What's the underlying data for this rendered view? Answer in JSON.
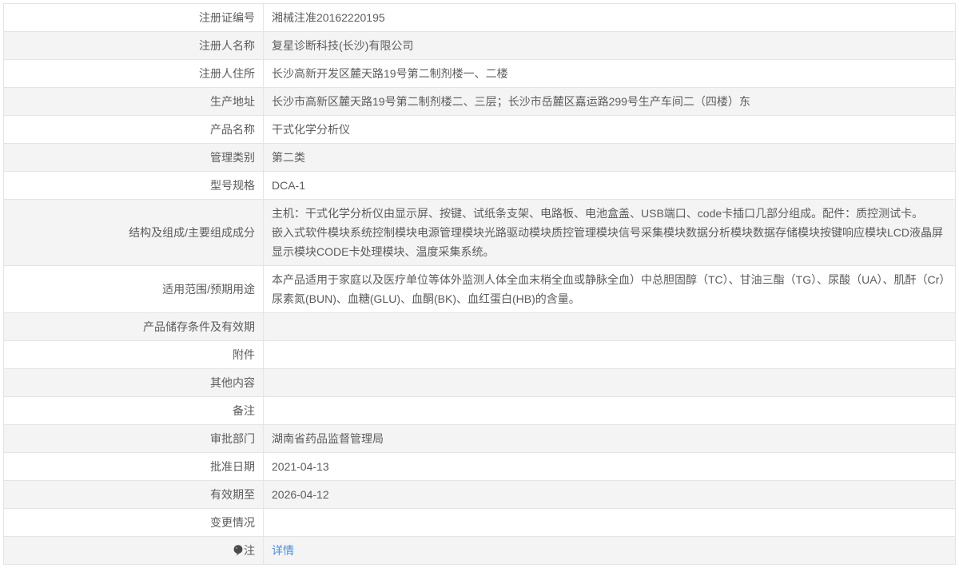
{
  "page": {
    "background": "#ffffff"
  },
  "table": {
    "colors": {
      "row_alt_bg": "#f4f4f4",
      "border": "#e4e4e4",
      "text": "#5c5c5c",
      "link": "#4a90d9",
      "note_icon": "#4a4a4a"
    },
    "label_column_width": 325,
    "rows": [
      {
        "key": "registration-cert-number",
        "label": "注册证编号",
        "value": "湘械注准20162220195"
      },
      {
        "key": "registrant-name",
        "label": "注册人名称",
        "value": "复星诊断科技(长沙)有限公司"
      },
      {
        "key": "registrant-address",
        "label": "注册人住所",
        "value": "长沙高新开发区麓天路19号第二制剂楼一、二楼"
      },
      {
        "key": "production-address",
        "label": "生产地址",
        "value": "长沙市高新区麓天路19号第二制剂楼二、三层；长沙市岳麓区嘉运路299号生产车间二（四楼）东"
      },
      {
        "key": "product-name",
        "label": "产品名称",
        "value": "干式化学分析仪"
      },
      {
        "key": "management-category",
        "label": "管理类别",
        "value": "第二类"
      },
      {
        "key": "model-spec",
        "label": "型号规格",
        "value": "DCA-1"
      },
      {
        "key": "structure-composition",
        "label": "结构及组成/主要组成成分",
        "value": "主机：干式化学分析仪由显示屏、按键、试纸条支架、电路板、电池盒盖、USB端口、code卡插口几部分组成。配件：质控测试卡。\n嵌入式软件模块系统控制模块电源管理模块光路驱动模块质控管理模块信号采集模块数据分析模块数据存储模块按键响应模块LCD液晶屏显示模块CODE卡处理模块、温度采集系统。"
      },
      {
        "key": "scope-of-application",
        "label": "适用范围/预期用途",
        "value": "本产品适用于家庭以及医疗单位等体外监测人体全血末梢全血或静脉全血）中总胆固醇（TC）、甘油三酯（TG）、尿酸（UA）、肌酐（Cr）尿素氮(BUN)、血糖(GLU)、血酮(BK)、血红蛋白(HB)的含量。"
      },
      {
        "key": "storage-conditions",
        "label": "产品储存条件及有效期",
        "value": ""
      },
      {
        "key": "attachments",
        "label": "附件",
        "value": ""
      },
      {
        "key": "other-content",
        "label": "其他内容",
        "value": ""
      },
      {
        "key": "remarks",
        "label": "备注",
        "value": ""
      },
      {
        "key": "approval-department",
        "label": "审批部门",
        "value": "湖南省药品监督管理局"
      },
      {
        "key": "approval-date",
        "label": "批准日期",
        "value": "2021-04-13"
      },
      {
        "key": "valid-until",
        "label": "有效期至",
        "value": "2026-04-12"
      },
      {
        "key": "change-status",
        "label": "变更情况",
        "value": ""
      },
      {
        "key": "note",
        "label": "注",
        "icon": "note-balloon-icon",
        "link_text": "详情"
      }
    ]
  }
}
